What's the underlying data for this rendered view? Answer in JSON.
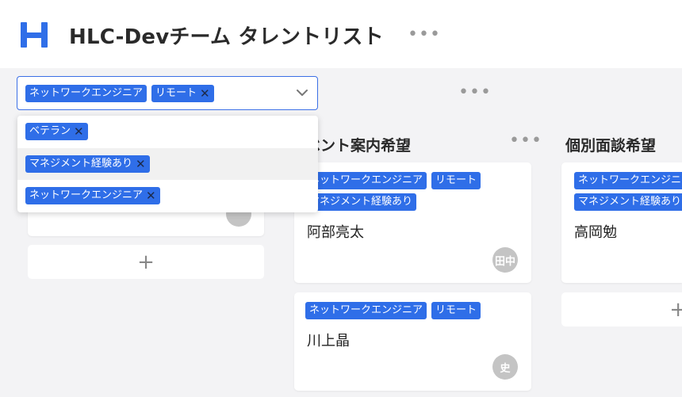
{
  "header": {
    "app_title": "HLC-Devチーム タレントリスト",
    "more_label": "•••"
  },
  "filter": {
    "selected_tags": [
      {
        "label": "ネットワークエンジニア"
      },
      {
        "label": "リモート",
        "remove": "✕"
      }
    ]
  },
  "dropdown": {
    "options": [
      {
        "label": "ベテラン",
        "remove": "✕"
      },
      {
        "label": "マネジメント経験あり",
        "remove": "✕"
      },
      {
        "label": "ネットワークエンジニア",
        "remove": "✕"
      }
    ]
  },
  "toolbar": {
    "more_label": "•••"
  },
  "columns": [
    {
      "add_label": "+",
      "cards": [
        {
          "avatar": ""
        }
      ]
    },
    {
      "title": "ベント案内希望",
      "more_label": "•••",
      "cards": [
        {
          "tags": [
            "ネットワークエンジニア",
            "リモート",
            "マネジメント経験あり"
          ],
          "name": "阿部亮太",
          "avatar": "田中"
        },
        {
          "tags": [
            "ネットワークエンジニア",
            "リモート"
          ],
          "name": "川上晶",
          "avatar": "史"
        }
      ]
    },
    {
      "title": "個別面談希望",
      "add_label": "+",
      "cards": [
        {
          "tags": [
            "ネットワークエンジニア",
            "マネジメント経験あり"
          ],
          "name": "高岡勉"
        }
      ]
    }
  ],
  "colors": {
    "accent": "#2f6ee8",
    "border_active": "#3b6fe6",
    "avatar": "#c4c4c4",
    "background": "#f3f3f5"
  }
}
